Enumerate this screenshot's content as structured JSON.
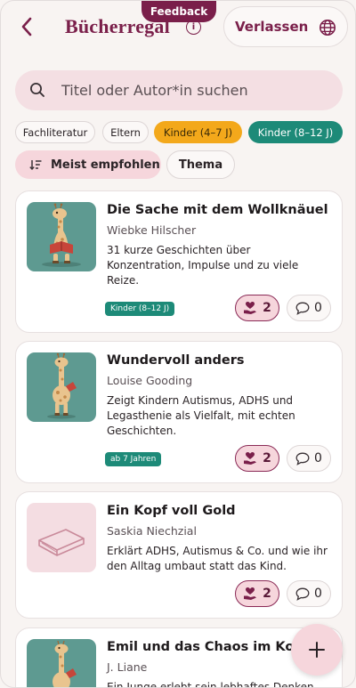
{
  "header": {
    "title": "Bücherregal",
    "info_label": "i",
    "feedback_label": "Feedback",
    "exit_label": "Verlassen"
  },
  "search": {
    "placeholder": "Titel oder Autor*in suchen"
  },
  "filters": [
    {
      "label": "Fachliteratur",
      "style": "plain"
    },
    {
      "label": "Eltern",
      "style": "plain"
    },
    {
      "label": "Kinder (4–7 J)",
      "style": "orange"
    },
    {
      "label": "Kinder (8–12 J)",
      "style": "teal"
    }
  ],
  "sort": {
    "label": "Meist empfohlen",
    "theme_label": "Thema"
  },
  "books": [
    {
      "title": "Die Sache mit dem Wollknäuel",
      "author": "Wiebke Hilscher",
      "description": "31 kurze Geschichten über Konzentration, Impulse und zu viele Reize.",
      "badge": "Kinder (8–12 J)",
      "likes": "2",
      "comments": "0",
      "cover": "giraffe-reading"
    },
    {
      "title": "Wundervoll anders",
      "author": "Louise Gooding",
      "description": "Zeigt Kindern Autismus, ADHS und Legasthenie als Vielfalt, mit echten Geschichten.",
      "badge": "ab 7 Jahren",
      "likes": "2",
      "comments": "0",
      "cover": "giraffe-standing"
    },
    {
      "title": "Ein Kopf voll Gold",
      "author": "Saskia Niechzial",
      "description": "Erklärt ADHS, Autismus & Co. und wie ihr den Alltag umbaut statt das Kind.",
      "badge": "",
      "likes": "2",
      "comments": "0",
      "cover": "book-outline"
    },
    {
      "title": "Emil und das Chaos im Kopf",
      "author": "J. Liane",
      "description": "Ein Junge erlebt sein lebhaftes Denken",
      "badge": "",
      "likes": "",
      "comments": "",
      "cover": "giraffe-standing"
    }
  ],
  "colors": {
    "accent": "#7a1f4a",
    "pink": "#f6d6dc",
    "teal": "#1d8a78",
    "orange": "#f3a81b"
  },
  "icons": {
    "back": "chevron-left-icon",
    "globe": "globe-icon",
    "search": "search-icon",
    "sort": "sort-icon",
    "like": "heart-hand-icon",
    "comment": "speech-bubble-icon",
    "fab": "plus-icon"
  }
}
